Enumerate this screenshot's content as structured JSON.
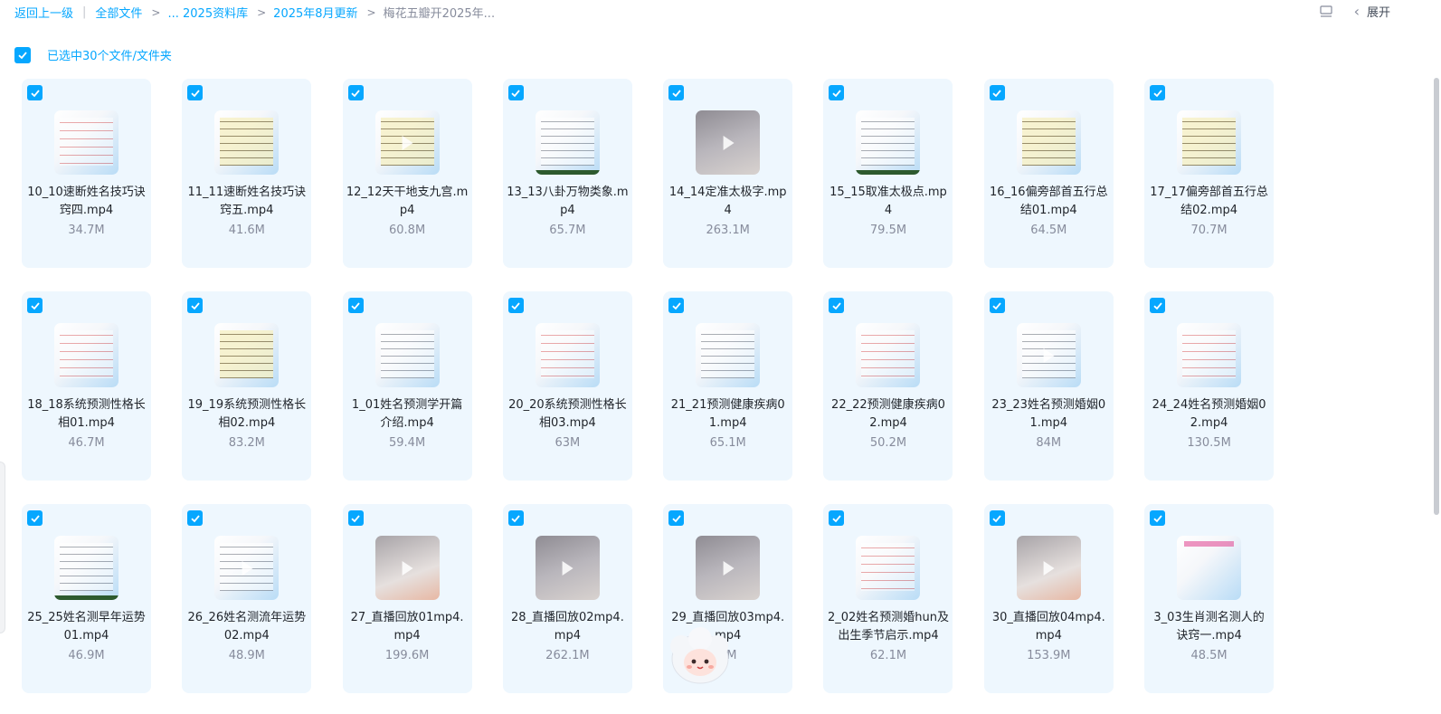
{
  "breadcrumb": {
    "back": "返回上一级",
    "all_files": "全部文件",
    "ellipsis_folder": "... 2025资料库",
    "month_folder": "2025年8月更新",
    "current": "梅花五瓣开2025年..."
  },
  "toolbar": {
    "view_toggle_icon": "list-view-icon",
    "expand_label": "展开"
  },
  "selection": {
    "label": "已选中30个文件/文件夹",
    "checked": true
  },
  "files": [
    {
      "name": "10_10速断姓名技巧诀窍四.mp4",
      "size": "34.7M",
      "thumb": "doc red"
    },
    {
      "name": "11_11速断姓名技巧诀窍五.mp4",
      "size": "41.6M",
      "thumb": "doc yellow"
    },
    {
      "name": "12_12天干地支九宫.mp4",
      "size": "60.8M",
      "thumb": "doc yellow play"
    },
    {
      "name": "13_13八卦万物类象.mp4",
      "size": "65.7M",
      "thumb": "doc bar"
    },
    {
      "name": "14_14定准太极字.mp4",
      "size": "263.1M",
      "thumb": "photo play"
    },
    {
      "name": "15_15取准太极点.mp4",
      "size": "79.5M",
      "thumb": "doc bar"
    },
    {
      "name": "16_16偏旁部首五行总结01.mp4",
      "size": "64.5M",
      "thumb": "doc yellow"
    },
    {
      "name": "17_17偏旁部首五行总结02.mp4",
      "size": "70.7M",
      "thumb": "doc yellow"
    },
    {
      "name": "18_18系统预测性格长相01.mp4",
      "size": "46.7M",
      "thumb": "doc red"
    },
    {
      "name": "19_19系统预测性格长相02.mp4",
      "size": "83.2M",
      "thumb": "doc yellow"
    },
    {
      "name": "1_01姓名预测学开篇介绍.mp4",
      "size": "59.4M",
      "thumb": "doc"
    },
    {
      "name": "20_20系统预测性格长相03.mp4",
      "size": "63M",
      "thumb": "doc red"
    },
    {
      "name": "21_21预测健康疾病01.mp4",
      "size": "65.1M",
      "thumb": "doc"
    },
    {
      "name": "22_22预测健康疾病02.mp4",
      "size": "50.2M",
      "thumb": "doc red"
    },
    {
      "name": "23_23姓名预测婚姻01.mp4",
      "size": "84M",
      "thumb": "doc play"
    },
    {
      "name": "24_24姓名预测婚姻02.mp4",
      "size": "130.5M",
      "thumb": "doc red"
    },
    {
      "name": "25_25姓名测早年运势01.mp4",
      "size": "46.9M",
      "thumb": "doc bar"
    },
    {
      "name": "26_26姓名测流年运势02.mp4",
      "size": "48.9M",
      "thumb": "doc play"
    },
    {
      "name": "27_直播回放01mp4.mp4",
      "size": "199.6M",
      "thumb": "hand play"
    },
    {
      "name": "28_直播回放02mp4.mp4",
      "size": "262.1M",
      "thumb": "photo play"
    },
    {
      "name": "29_直播回放03mp4.mp4",
      "size": "7M",
      "thumb": "photo play"
    },
    {
      "name": "2_02姓名预测婚hun及出生季节启示.mp4",
      "size": "62.1M",
      "thumb": "doc red"
    },
    {
      "name": "30_直播回放04mp4.mp4",
      "size": "153.9M",
      "thumb": "hand play"
    },
    {
      "name": "3_03生肖测名测人的诀窍一.mp4",
      "size": "48.5M",
      "thumb": "doc pink"
    }
  ],
  "colors": {
    "accent": "#06a7ff",
    "card_bg": "#eef7fe",
    "muted_text": "#878c9c"
  },
  "mascot_icon": "cloud-mascot-icon"
}
